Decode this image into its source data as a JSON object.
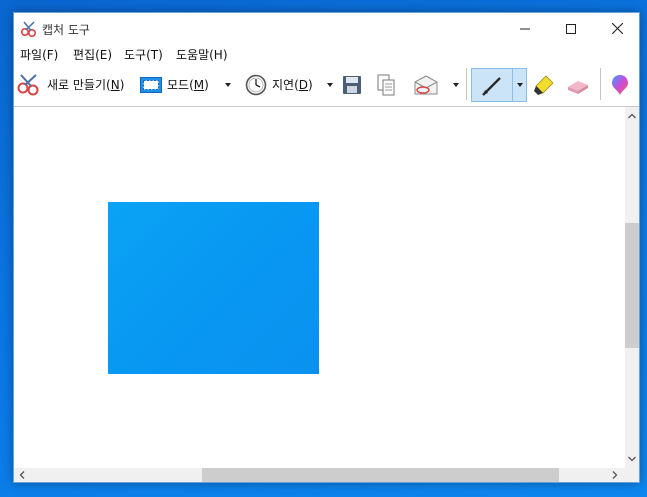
{
  "window": {
    "title": "캡처 도구",
    "accent_color": "#0078d7"
  },
  "menu": {
    "items": [
      {
        "label": "파일(F)"
      },
      {
        "label": "편집(E)"
      },
      {
        "label": "도구(T)"
      },
      {
        "label": "도움말(H)"
      }
    ]
  },
  "toolbar": {
    "new_label": "새로 만들기(",
    "new_key": "N",
    "mode_label": "모드(",
    "mode_key": "M",
    "delay_label": "지연(",
    "delay_key": "D",
    "close_paren": ")",
    "icons": {
      "new": "scissors-icon",
      "mode": "rectangle-snip-icon",
      "delay": "clock-icon",
      "save": "floppy-disk-icon",
      "copy": "copy-icon",
      "send": "envelope-icon",
      "pen": "pen-icon",
      "highlighter": "highlighter-icon",
      "eraser": "eraser-icon",
      "paint3d": "paint-3d-icon"
    }
  },
  "canvas": {
    "snip_color": "#0a9bf3"
  }
}
